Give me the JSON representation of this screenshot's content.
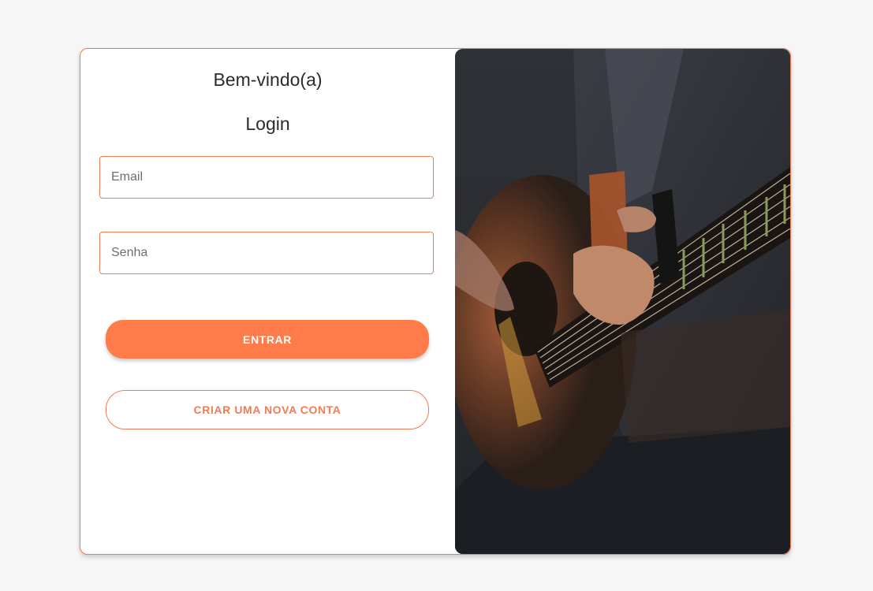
{
  "login": {
    "welcome": "Bem-vindo(a)",
    "title": "Login",
    "email_placeholder": "Email",
    "password_placeholder": "Senha",
    "submit_label": "ENTRAR",
    "create_account_label": "CRIAR UMA NOVA CONTA"
  },
  "image": {
    "subject": "guitarist-playing-acoustic-guitar-photo"
  },
  "colors": {
    "accent": "#ff7b4a",
    "border": "#f07c54",
    "page_background": "#f6f6f6",
    "card_background": "#ffffff",
    "text": "#2b2b2b"
  }
}
